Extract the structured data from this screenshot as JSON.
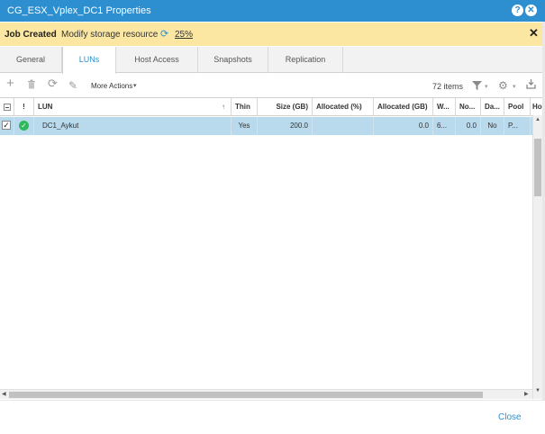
{
  "window": {
    "title": "CG_ESX_Vplex_DC1 Properties",
    "help_label": "?",
    "close_label": "✕"
  },
  "job_bar": {
    "title": "Job Created",
    "description": "Modify storage resource",
    "progress": "25%",
    "close_label": "✕"
  },
  "tabs": [
    {
      "label": "General",
      "active": false
    },
    {
      "label": "LUNs",
      "active": true
    },
    {
      "label": "Host Access",
      "active": false
    },
    {
      "label": "Snapshots",
      "active": false
    },
    {
      "label": "Replication",
      "active": false
    }
  ],
  "toolbar": {
    "add_icon": "+",
    "delete_icon": "🗑",
    "refresh_icon": "⟳",
    "edit_icon": "✎",
    "more_actions": "More Actions",
    "item_count": "72 items",
    "filter_icon": "filter",
    "settings_icon": "gear",
    "export_icon": "export"
  },
  "table": {
    "headers": [
      "",
      "!",
      "LUN",
      "Thin",
      "Size (GB)",
      "Allocated (%)",
      "Allocated (GB)",
      "W...",
      "No...",
      "Da...",
      "Pool",
      "Ho"
    ],
    "rows": [
      {
        "selected": true,
        "status": "ok",
        "lun": "DC1_Aykut",
        "thin": "Yes",
        "size": "200.0",
        "allocated_pct": "",
        "allocated_gb": "0.0",
        "w": "6...",
        "no": "0.0",
        "da": "No",
        "pool": "P...",
        "ho": ""
      }
    ]
  },
  "footer": {
    "close_label": "Close"
  },
  "colors": {
    "accent": "#2d8fd0",
    "job_bar": "#fbe7a2",
    "row_selected": "#b9d9ec",
    "status_ok": "#2eb85c"
  }
}
